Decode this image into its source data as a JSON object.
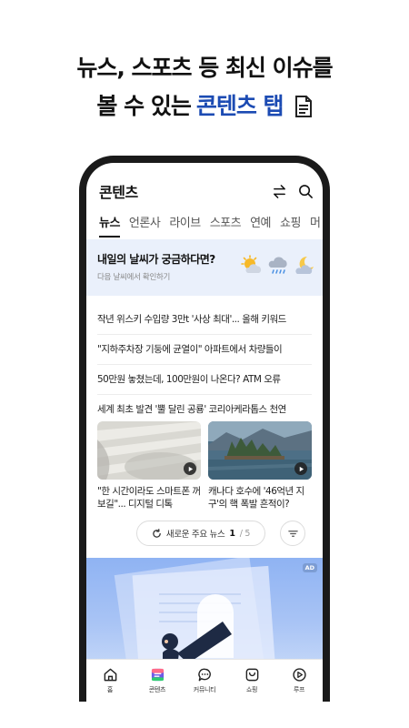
{
  "promo": {
    "line1": "뉴스, 스포츠 등 최신 이슈를",
    "line2_prefix": "볼 수 있는",
    "line2_accent": "콘텐츠 탭"
  },
  "app": {
    "title": "콘텐츠",
    "tabs": [
      "뉴스",
      "언론사",
      "라이브",
      "스포츠",
      "연예",
      "쇼핑",
      "머"
    ],
    "weather": {
      "question": "내일의 날씨가 궁금하다면?",
      "subtitle": "다음 날씨에서 확인하기"
    },
    "news": [
      "작년 위스키 수입량 3만t '사상 최대'... 올해 키워드",
      "\"지하주차장 기둥에 균열이\" 아파트에서 차량들이",
      "50만원 놓쳤는데, 100만원이 나온다? ATM 오류",
      "세계 최초 발견 '뿔 달린 공룡' 코리아케라톱스 천연"
    ],
    "cards": [
      {
        "caption": "\"한 시간이라도 스마트폰 꺼 보길\"... 디지털 디톡"
      },
      {
        "caption": "캐나다 호수에 '46억년 지구'의 핵 폭발 흔적이?"
      }
    ],
    "more": {
      "label": "새로운 주요 뉴스",
      "current": "1",
      "total": "/ 5"
    },
    "ad_badge": "AD",
    "bottom_nav": [
      {
        "label": "홈",
        "icon": "home-icon"
      },
      {
        "label": "콘텐츠",
        "icon": "contents-icon"
      },
      {
        "label": "커뮤니티",
        "icon": "chat-icon"
      },
      {
        "label": "쇼핑",
        "icon": "shopping-icon"
      },
      {
        "label": "루프",
        "icon": "play-icon"
      }
    ]
  },
  "colors": {
    "accent": "#1c4bb3",
    "weather_bg": "#eaf0fb",
    "ad_bg": "#8fb3f3"
  }
}
